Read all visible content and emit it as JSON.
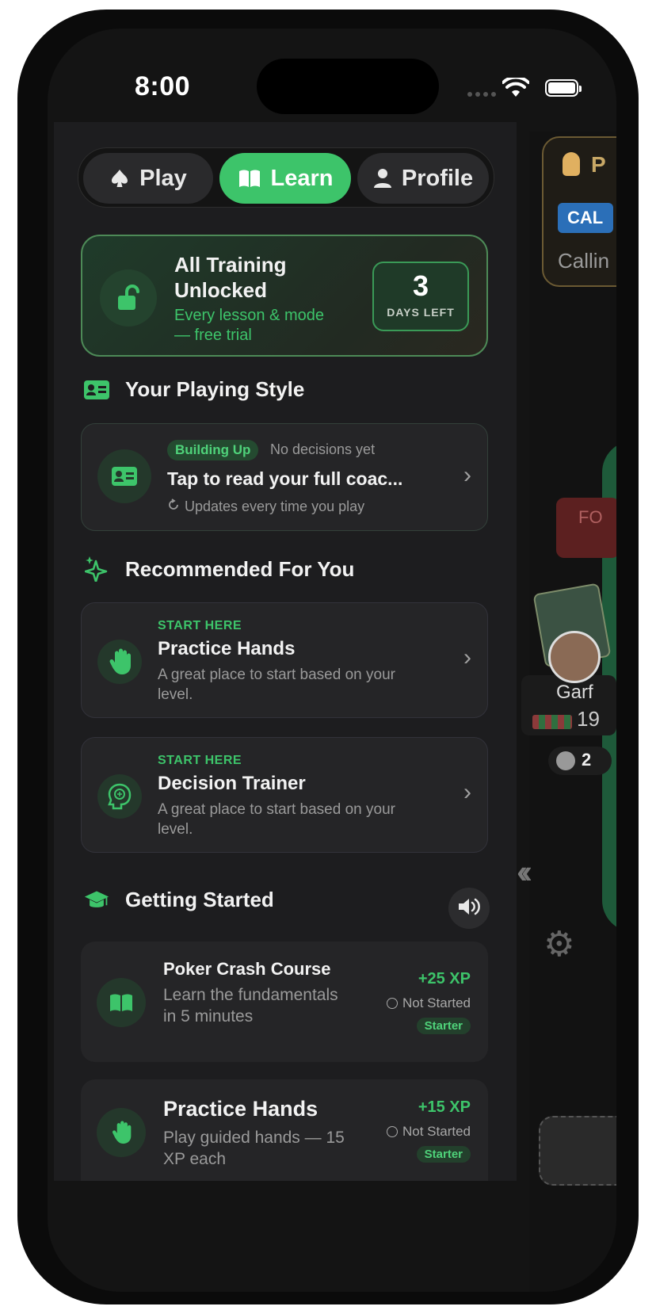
{
  "status_bar": {
    "time": "8:00"
  },
  "tabs": [
    {
      "label": "Play",
      "icon": "spade-icon"
    },
    {
      "label": "Learn",
      "icon": "book-icon",
      "active": true
    },
    {
      "label": "Profile",
      "icon": "person-icon"
    }
  ],
  "trial_banner": {
    "title": "All Training Unlocked",
    "subtitle": "Every lesson & mode — free trial",
    "days_value": "3",
    "days_label": "DAYS LEFT"
  },
  "playing_style": {
    "heading": "Your Playing Style",
    "badge": "Building Up",
    "status": "No decisions yet",
    "title": "Tap to read your full coac...",
    "update_note": "Updates every time you play"
  },
  "recommended": {
    "heading": "Recommended For You",
    "items": [
      {
        "kicker": "START HERE",
        "title": "Practice Hands",
        "desc": "A great place to start based on your level.",
        "icon": "hand-icon"
      },
      {
        "kicker": "START HERE",
        "title": "Decision Trainer",
        "desc": "A great place to start based on your level.",
        "icon": "brain-icon"
      }
    ]
  },
  "getting_started": {
    "heading": "Getting Started",
    "lessons": [
      {
        "title": "Poker Crash Course",
        "desc": "Learn the fundamentals in 5 minutes",
        "xp": "+25 XP",
        "status": "Not Started",
        "tag": "Starter",
        "icon": "book-icon"
      },
      {
        "title": "Practice Hands",
        "desc": "Play guided hands — 15 XP each",
        "xp": "+15 XP",
        "status": "Not Started",
        "tag": "Starter",
        "icon": "hand-icon"
      }
    ]
  },
  "background_game": {
    "tip_title": "P",
    "tip_badge": "CAL",
    "tip_text": "Callin",
    "fold_label": "FO",
    "player_name": "Garf",
    "player_chips": "19",
    "bet_amount": "2"
  },
  "colors": {
    "accent": "#3dc46a",
    "panel": "#1d1d1f",
    "card": "#252527"
  }
}
